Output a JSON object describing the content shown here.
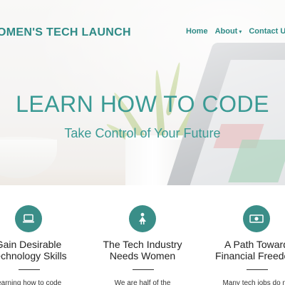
{
  "header": {
    "site_title": "OMEN'S TECH LAUNCH",
    "nav": {
      "home": "Home",
      "about": "About",
      "about_caret": "▾",
      "contact": "Contact Us"
    }
  },
  "hero": {
    "headline": "LEARN HOW TO CODE",
    "tagline": "Take Control of Your Future"
  },
  "features": [
    {
      "icon": "laptop-icon",
      "title_line1": "Gain Desirable",
      "title_line2": "Technology Skills",
      "body": "learning how to code"
    },
    {
      "icon": "woman-icon",
      "title_line1": "The Tech Industry",
      "title_line2": "Needs Women",
      "body": "We are half of the"
    },
    {
      "icon": "money-icon",
      "title_line1": "A Path Toward",
      "title_line2": "Financial Freedom",
      "body": "Many tech jobs do no"
    }
  ],
  "colors": {
    "accent": "#3a9a94",
    "icon_circle": "#3a8e88"
  }
}
